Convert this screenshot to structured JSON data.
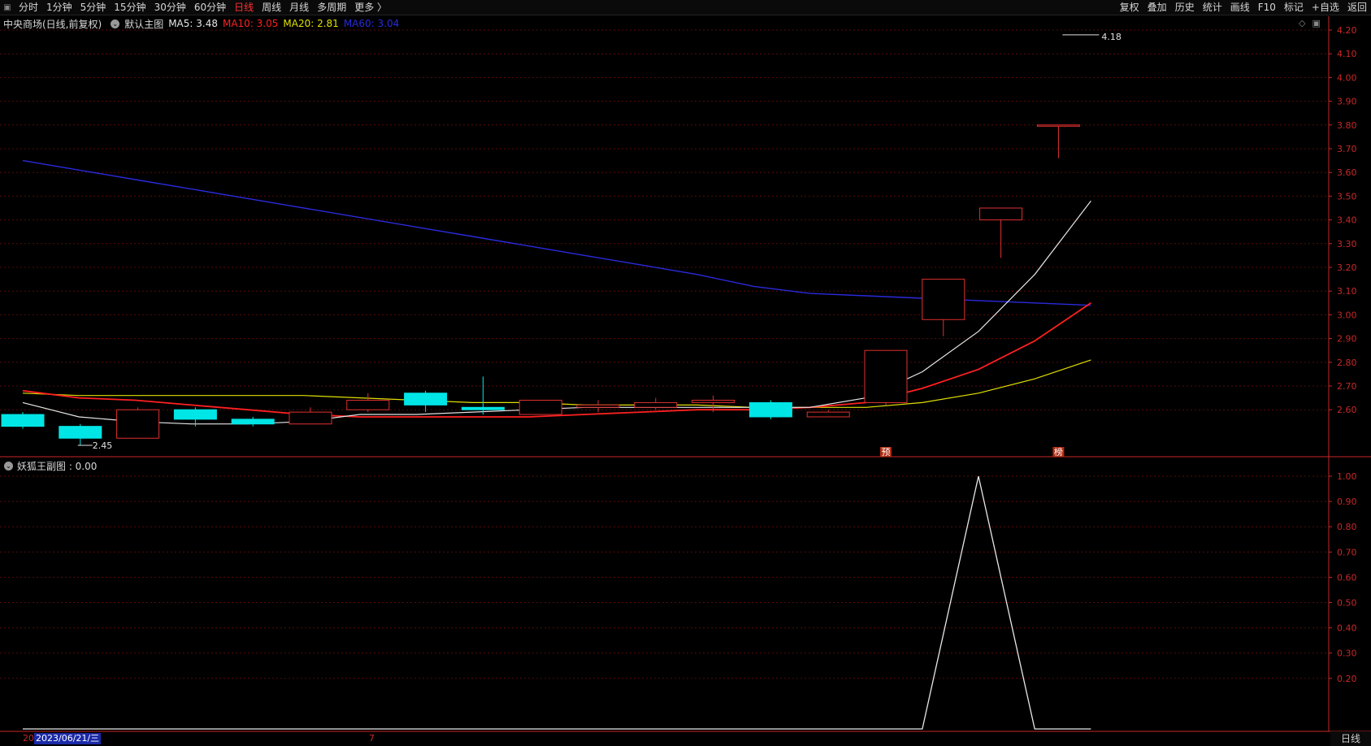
{
  "toolbar": {
    "left_items": [
      "分时",
      "1分钟",
      "5分钟",
      "15分钟",
      "30分钟",
      "60分钟",
      "日线",
      "周线",
      "月线",
      "多周期",
      "更多 〉"
    ],
    "active_index": 6,
    "right_items": [
      "复权",
      "叠加",
      "历史",
      "统计",
      "画线",
      "F10",
      "标记",
      "+自选",
      "返回"
    ]
  },
  "main_chart": {
    "stock_title": "中央商场(日线,前复权)",
    "template": "默认主图",
    "ma5": "MA5: 3.48",
    "ma10": "MA10: 3.05",
    "ma20": "MA20: 2.81",
    "ma60": "MA60: 3.04",
    "max_label": "4.18",
    "min_label": "2.45",
    "marker_1": "预",
    "marker_2": "榜",
    "price_axis": [
      "4.20",
      "4.10",
      "4.00",
      "3.90",
      "3.80",
      "3.70",
      "3.60",
      "3.50",
      "3.40",
      "3.30",
      "3.20",
      "3.10",
      "3.00",
      "2.90",
      "2.80",
      "2.70",
      "2.60"
    ]
  },
  "sub_chart": {
    "title": "妖狐王副图 : 0.00",
    "axis": [
      "1.00",
      "0.90",
      "0.80",
      "0.70",
      "0.60",
      "0.50",
      "0.40",
      "0.30",
      "0.20"
    ]
  },
  "footer": {
    "date_prefix": "20",
    "date": "2023/06/21/三",
    "mark": "7",
    "period_tab": "日线"
  },
  "colors": {
    "ma5": "#e6e6e6",
    "ma10": "#ff2020",
    "ma20": "#e0e000",
    "ma60": "#2a2adc",
    "up": "#e03030",
    "down": "#00e5e5",
    "grid": "#5a0a0a",
    "axis_text": "#c82828"
  },
  "candles": [
    {
      "open": 2.58,
      "close": 2.53,
      "high": 2.59,
      "low": 2.52
    },
    {
      "open": 2.53,
      "close": 2.48,
      "high": 2.54,
      "low": 2.45
    },
    {
      "open": 2.48,
      "close": 2.6,
      "high": 2.61,
      "low": 2.48
    },
    {
      "open": 2.6,
      "close": 2.56,
      "high": 2.61,
      "low": 2.53
    },
    {
      "open": 2.56,
      "close": 2.54,
      "high": 2.57,
      "low": 2.53
    },
    {
      "open": 2.54,
      "close": 2.59,
      "high": 2.61,
      "low": 2.54
    },
    {
      "open": 2.6,
      "close": 2.64,
      "high": 2.67,
      "low": 2.59
    },
    {
      "open": 2.67,
      "close": 2.62,
      "high": 2.68,
      "low": 2.59
    },
    {
      "open": 2.61,
      "close": 2.6,
      "high": 2.74,
      "low": 2.58
    },
    {
      "open": 2.58,
      "close": 2.64,
      "high": 2.64,
      "low": 2.58
    },
    {
      "open": 2.61,
      "close": 2.62,
      "high": 2.64,
      "low": 2.59
    },
    {
      "open": 2.61,
      "close": 2.63,
      "high": 2.65,
      "low": 2.6
    },
    {
      "open": 2.63,
      "close": 2.64,
      "high": 2.66,
      "low": 2.59
    },
    {
      "open": 2.63,
      "close": 2.57,
      "high": 2.64,
      "low": 2.56
    },
    {
      "open": 2.57,
      "close": 2.59,
      "high": 2.6,
      "low": 2.57
    },
    {
      "open": 2.63,
      "close": 2.85,
      "high": 2.85,
      "low": 2.62
    },
    {
      "open": 2.98,
      "close": 3.15,
      "high": 3.15,
      "low": 2.91
    },
    {
      "open": 3.4,
      "close": 3.45,
      "high": 3.45,
      "low": 3.24
    },
    {
      "open": 3.8,
      "close": 3.8,
      "high": 3.8,
      "low": 3.66
    }
  ],
  "ma5_values": [
    2.63,
    2.57,
    2.55,
    2.54,
    2.54,
    2.55,
    2.58,
    2.58,
    2.59,
    2.6,
    2.61,
    2.61,
    2.61,
    2.61,
    2.61,
    2.65,
    2.76,
    2.93,
    3.17,
    3.48
  ],
  "ma10_values": [
    2.68,
    2.65,
    2.64,
    2.62,
    2.6,
    2.58,
    2.57,
    2.57,
    2.57,
    2.57,
    2.58,
    2.59,
    2.6,
    2.6,
    2.61,
    2.63,
    2.69,
    2.77,
    2.89,
    3.05
  ],
  "ma20_values": [
    2.67,
    2.66,
    2.66,
    2.66,
    2.66,
    2.66,
    2.65,
    2.64,
    2.63,
    2.63,
    2.62,
    2.62,
    2.62,
    2.61,
    2.61,
    2.61,
    2.63,
    2.67,
    2.73,
    2.81
  ],
  "ma60_values": [
    3.65,
    3.61,
    3.57,
    3.53,
    3.49,
    3.45,
    3.41,
    3.37,
    3.33,
    3.29,
    3.25,
    3.21,
    3.17,
    3.12,
    3.09,
    3.08,
    3.07,
    3.06,
    3.05,
    3.04
  ],
  "sub_values": [
    0,
    0,
    0,
    0,
    0,
    0,
    0,
    0,
    0,
    0,
    0,
    0,
    0,
    0,
    0,
    0,
    0,
    1,
    0,
    0
  ]
}
